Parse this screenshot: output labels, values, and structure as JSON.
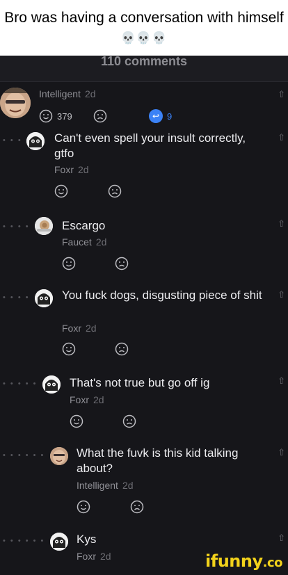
{
  "caption": {
    "text": "Bro was having a conversation with himself",
    "emoji": "💀💀💀"
  },
  "header": {
    "title": "110 comments"
  },
  "top_comment": {
    "username": "Intelligent",
    "time": "2d",
    "smile_count": "379",
    "reply_count": "9"
  },
  "replies": [
    {
      "text": "Can't even spell your insult correctly, gtfo",
      "username": "Foxr",
      "time": "2d",
      "dots": "• • •"
    },
    {
      "text": "Escargo",
      "username": "Faucet",
      "time": "2d",
      "dots": "• • • •"
    },
    {
      "text": "You fuck dogs, disgusting piece of shit",
      "username": "Foxr",
      "time": "2d",
      "dots": "• • • •"
    },
    {
      "text": "That's not true but go off ig",
      "username": "Foxr",
      "time": "2d",
      "dots": "• • • • •"
    },
    {
      "text": "What the fuvk is this kid talking about?",
      "username": "Intelligent",
      "time": "2d",
      "dots": "• • • • • •"
    },
    {
      "text": "Kys",
      "username": "Foxr",
      "time": "2d",
      "dots": "• • • • • •"
    }
  ],
  "watermark": {
    "text": "ifunny",
    "suffix": ".co"
  },
  "colors": {
    "background": "#16161a",
    "accent": "#3b82f6",
    "watermark": "#f2d21b"
  }
}
